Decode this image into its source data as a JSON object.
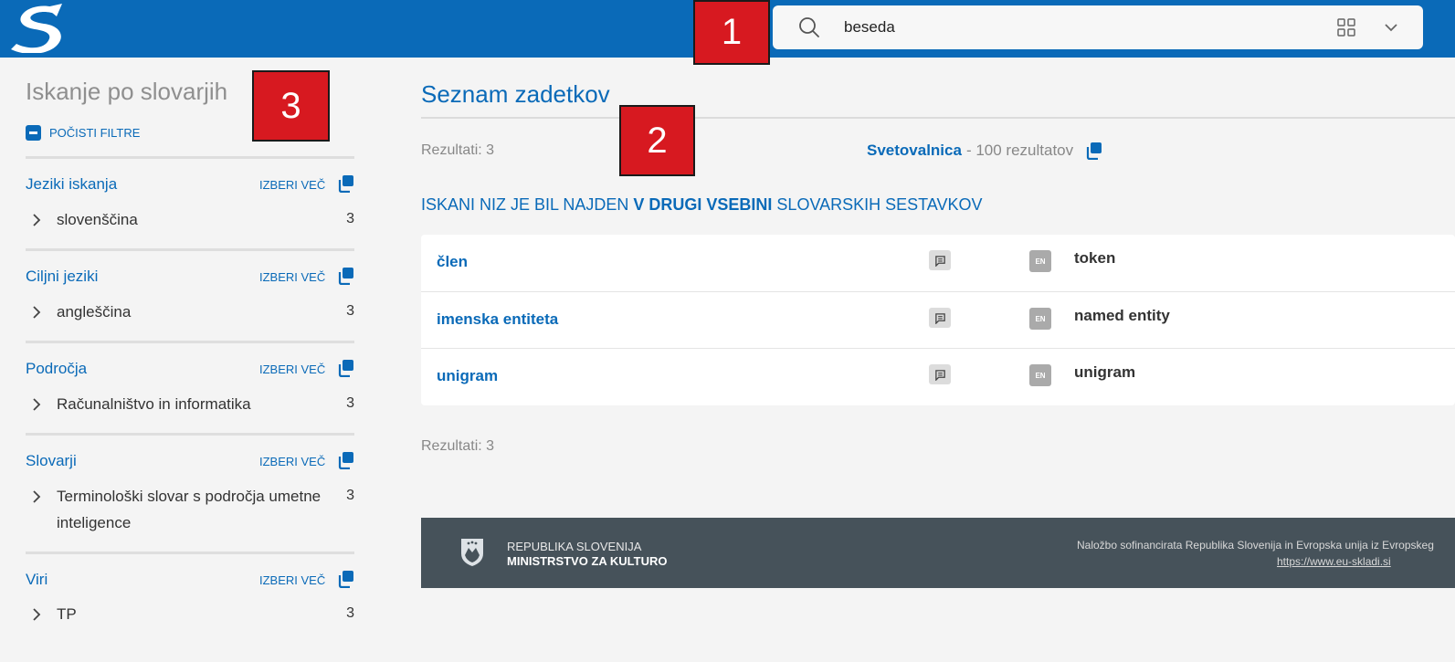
{
  "header": {
    "search": {
      "value": "beseda",
      "placeholder": ""
    },
    "icons": {
      "logo": "s-logo-icon",
      "search": "search-icon",
      "mode": "grid-icon",
      "toggle": "chevron-down-icon"
    }
  },
  "markers": [
    "1",
    "2",
    "3"
  ],
  "sidebar": {
    "title": "Iskanje po slovarjih",
    "clear_label": "POČISTI FILTRE",
    "groups": [
      {
        "name": "Jeziki iskanja",
        "more": "IZBERI VEČ",
        "items": [
          {
            "label": "slovenščina",
            "count": "3"
          }
        ]
      },
      {
        "name": "Ciljni jeziki",
        "more": "IZBERI VEČ",
        "items": [
          {
            "label": "angleščina",
            "count": "3"
          }
        ]
      },
      {
        "name": "Področja",
        "more": "IZBERI VEČ",
        "items": [
          {
            "label": "Računalništvo in informatika",
            "count": "3"
          }
        ]
      },
      {
        "name": "Slovarji",
        "more": "IZBERI VEČ",
        "items": [
          {
            "label": "Terminološki slovar s področja umetne inteligence",
            "count": "3"
          }
        ]
      },
      {
        "name": "Viri",
        "more": "IZBERI VEČ",
        "items": [
          {
            "label": "TP",
            "count": "3"
          }
        ]
      }
    ]
  },
  "main": {
    "title": "Seznam zadetkov",
    "results_count": "Rezultati: 3",
    "svetovalnica": {
      "link": "Svetovalnica",
      "rest": "- 100 rezultatov"
    },
    "notice": {
      "before": "ISKANI NIZ JE BIL NAJDEN ",
      "bold": "V DRUGI VSEBINI",
      "after": " SLOVARSKIH SESTAVKOV"
    },
    "results": [
      {
        "term": "člen",
        "lang": "EN",
        "translation": "token"
      },
      {
        "term": "imenska entiteta",
        "lang": "EN",
        "translation": "named entity"
      },
      {
        "term": "unigram",
        "lang": "EN",
        "translation": "unigram"
      }
    ],
    "results_count_bottom": "Rezultati: 3"
  },
  "footer": {
    "line1": "REPUBLIKA SLOVENIJA",
    "line2": "MINISTRSTVO ZA KULTURO",
    "funding": "Naložbo sofinancirata Republika Slovenija in Evropska unija iz Evropskeg",
    "link": "https://www.eu-skladi.si"
  },
  "colors": {
    "primary": "#0a6ab8",
    "marker": "#d71920",
    "footer": "#46525a",
    "background": "#f4f4f4"
  }
}
